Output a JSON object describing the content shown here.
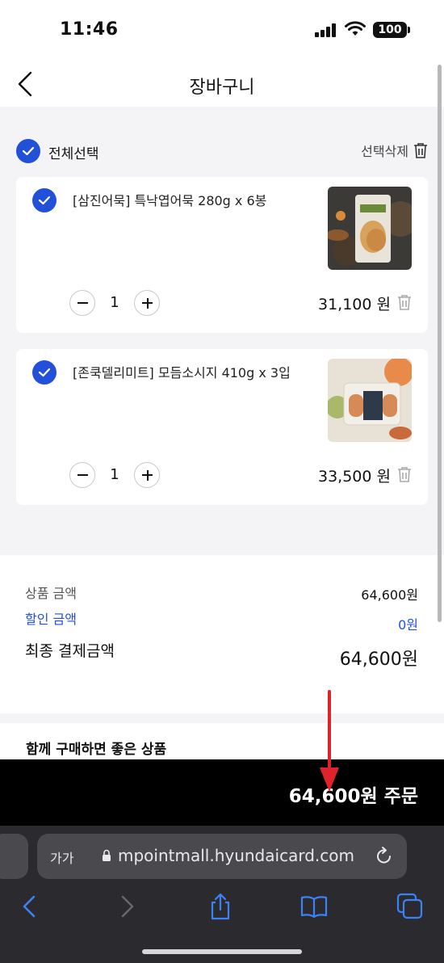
{
  "status_bar": {
    "time": "11:46",
    "battery": "100"
  },
  "header": {
    "title": "장바구니"
  },
  "cart": {
    "select_all_label": "전체선택",
    "delete_selected_label": "선택삭제",
    "items": [
      {
        "name": "[삼진어묵] 특낙엽어묵 280g x 6봉",
        "quantity": "1",
        "price": "31,100 원",
        "checked": true
      },
      {
        "name": "[존쿡델리미트] 모듬소시지 410g x 3입",
        "quantity": "1",
        "price": "33,500 원",
        "checked": true
      }
    ]
  },
  "summary": {
    "product_amount_label": "상품 금액",
    "product_amount_value": "64,600원",
    "discount_label": "할인 금액",
    "discount_value": "0원",
    "final_label": "최종 결제금액",
    "final_value": "64,600원"
  },
  "recommend": {
    "title": "함께 구매하면 좋은 상품"
  },
  "order_button": {
    "label": "64,600원 주문"
  },
  "browser": {
    "aa_label": "가가",
    "url": "mpointmall.hyundaicard.com"
  },
  "colors": {
    "accent": "#2350d8",
    "order_bar": "#000000",
    "annotation_arrow": "#e0222c"
  }
}
